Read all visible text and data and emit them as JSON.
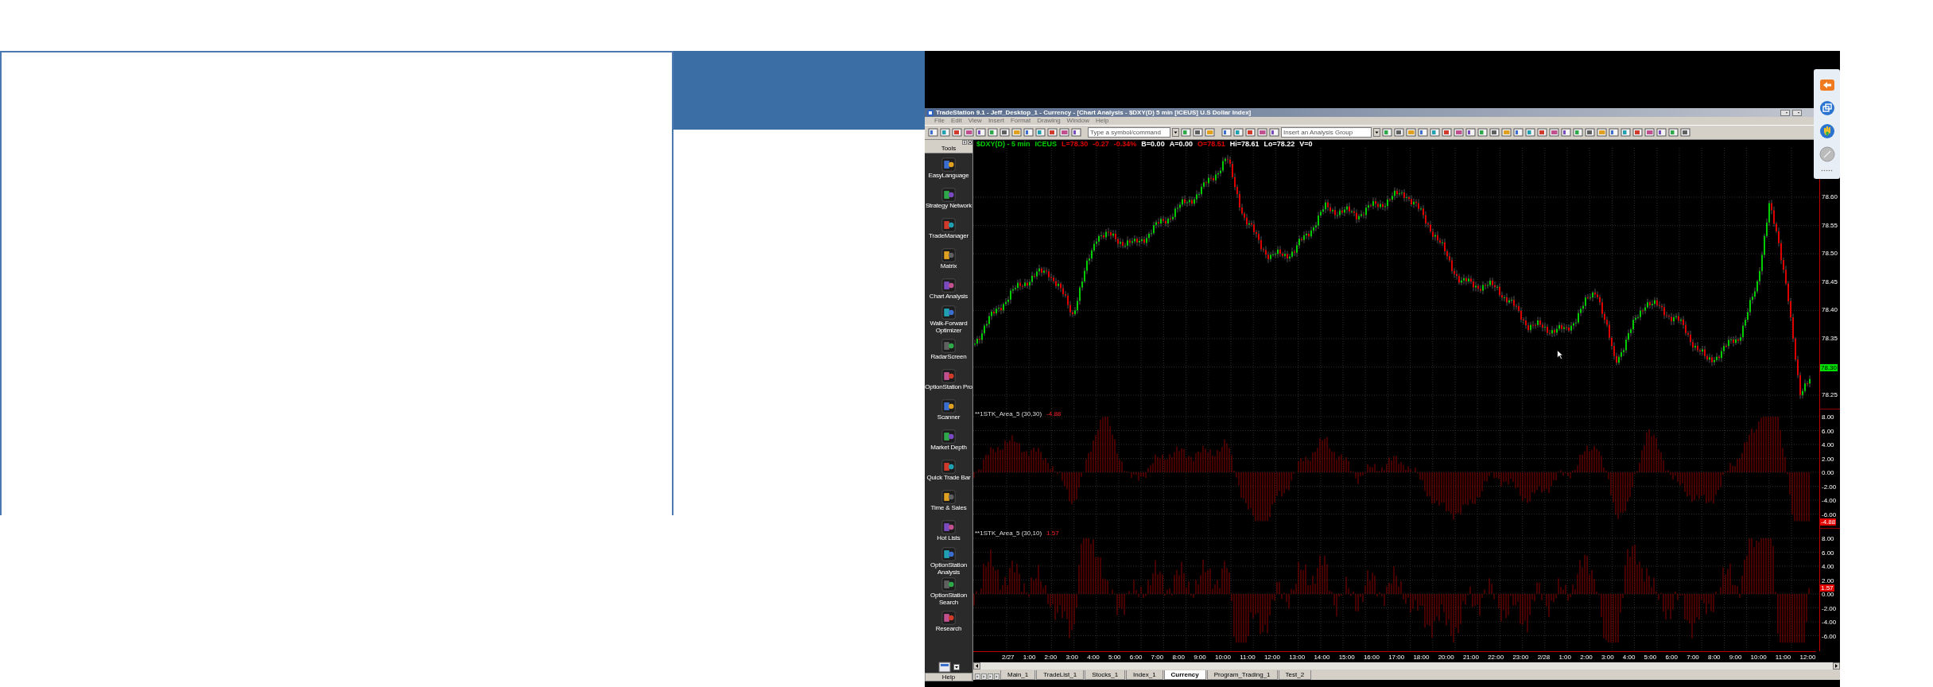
{
  "window": {
    "title": "TradeStation 9.1 - Jeff_Desktop_1 - Currency - [Chart Analysis - $DXY(D) 5 min [ICEUS] U.S Dollar Index]",
    "menu": [
      "File",
      "Edit",
      "View",
      "Insert",
      "Format",
      "Drawing",
      "Window",
      "Help"
    ],
    "toolbar": {
      "symbol_field": {
        "placeholder": "Type a symbol/command"
      },
      "analysis_group_field": {
        "placeholder": "Insert an Analysis Group"
      }
    }
  },
  "tools_panel": {
    "title": "Tools",
    "items": [
      {
        "label": "EasyLanguage"
      },
      {
        "label": "Strategy Network"
      },
      {
        "label": "TradeManager"
      },
      {
        "label": "Matrix"
      },
      {
        "label": "Chart Analysis"
      },
      {
        "label": "Walk-Forward Optimizer"
      },
      {
        "label": "RadarScreen"
      },
      {
        "label": "OptionStation Pro"
      },
      {
        "label": "Scanner"
      },
      {
        "label": "Market Depth"
      },
      {
        "label": "Quick Trade Bar"
      },
      {
        "label": "Time & Sales"
      },
      {
        "label": "Hot Lists"
      },
      {
        "label": "OptionStation Analysis"
      },
      {
        "label": "OptionStation Search"
      },
      {
        "label": "Research"
      }
    ],
    "help": "Help"
  },
  "chart": {
    "status": [
      {
        "text": "$DXY(D) - 5 min",
        "color": "#00d000"
      },
      {
        "text": "ICEUS",
        "color": "#00d000"
      },
      {
        "text": "L=78.30",
        "color": "#e00000"
      },
      {
        "text": "-0.27",
        "color": "#e00000"
      },
      {
        "text": "-0.34%",
        "color": "#e00000"
      },
      {
        "text": "B=0.00",
        "color": "#ffffff"
      },
      {
        "text": "A=0.00",
        "color": "#ffffff"
      },
      {
        "text": "O=78.51",
        "color": "#e00000"
      },
      {
        "text": "Hi=78.61",
        "color": "#ffffff"
      },
      {
        "text": "Lo=78.22",
        "color": "#ffffff"
      },
      {
        "text": "V=0",
        "color": "#ffffff"
      }
    ],
    "price_axis": [
      {
        "text": "78.60",
        "kind": "label"
      },
      {
        "text": "78.55",
        "kind": "label"
      },
      {
        "text": "78.50",
        "kind": "label"
      },
      {
        "text": "78.45",
        "kind": "label"
      },
      {
        "text": "78.40",
        "kind": "label"
      },
      {
        "text": "78.35",
        "kind": "label"
      },
      {
        "text": "78.30",
        "kind": "badge",
        "color": "#00e000"
      },
      {
        "text": "78.25",
        "kind": "label"
      }
    ],
    "indicators": [
      {
        "label": "**1STK_Area_5 (30,30)",
        "value": "-4.88",
        "axis": [
          {
            "text": "8.00",
            "kind": "label"
          },
          {
            "text": "6.00",
            "kind": "label"
          },
          {
            "text": "4.00",
            "kind": "label"
          },
          {
            "text": "2.00",
            "kind": "label"
          },
          {
            "text": "0.00",
            "kind": "label"
          },
          {
            "text": "-2.00",
            "kind": "label"
          },
          {
            "text": "-4.00",
            "kind": "label"
          },
          {
            "text": "-6.00",
            "kind": "label"
          },
          {
            "text": "-4.88",
            "kind": "badge",
            "color": "#e00000"
          }
        ]
      },
      {
        "label": "**1STK_Area_5 (30,10)",
        "value": "1.57",
        "axis": [
          {
            "text": "8.00",
            "kind": "label"
          },
          {
            "text": "6.00",
            "kind": "label"
          },
          {
            "text": "4.00",
            "kind": "label"
          },
          {
            "text": "2.00",
            "kind": "label"
          },
          {
            "text": "1.57",
            "kind": "badge",
            "color": "#e00000"
          },
          {
            "text": "0.00",
            "kind": "label"
          },
          {
            "text": "-2.00",
            "kind": "label"
          },
          {
            "text": "-4.00",
            "kind": "label"
          },
          {
            "text": "-6.00",
            "kind": "label"
          }
        ]
      }
    ],
    "time_axis": [
      "2/27",
      "1:00",
      "2:00",
      "3:00",
      "4:00",
      "5:00",
      "6:00",
      "7:00",
      "8:00",
      "9:00",
      "10:00",
      "11:00",
      "12:00",
      "13:00",
      "14:00",
      "15:00",
      "16:00",
      "17:00",
      "18:00",
      "20:00",
      "21:00",
      "22:00",
      "23:00",
      "2/28",
      "1:00",
      "2:00",
      "3:00",
      "4:00",
      "5:00",
      "6:00",
      "7:00",
      "8:00",
      "9:00",
      "10:00",
      "11:00",
      "12:00"
    ]
  },
  "tabs": [
    {
      "label": "Main_1",
      "selected": false
    },
    {
      "label": "TradeList_1",
      "selected": false
    },
    {
      "label": "Stocks_1",
      "selected": false
    },
    {
      "label": "Index_1",
      "selected": false
    },
    {
      "label": "Currency",
      "selected": true
    },
    {
      "label": "Program_Trading_1",
      "selected": false
    },
    {
      "label": "Test_2",
      "selected": false
    }
  ]
}
